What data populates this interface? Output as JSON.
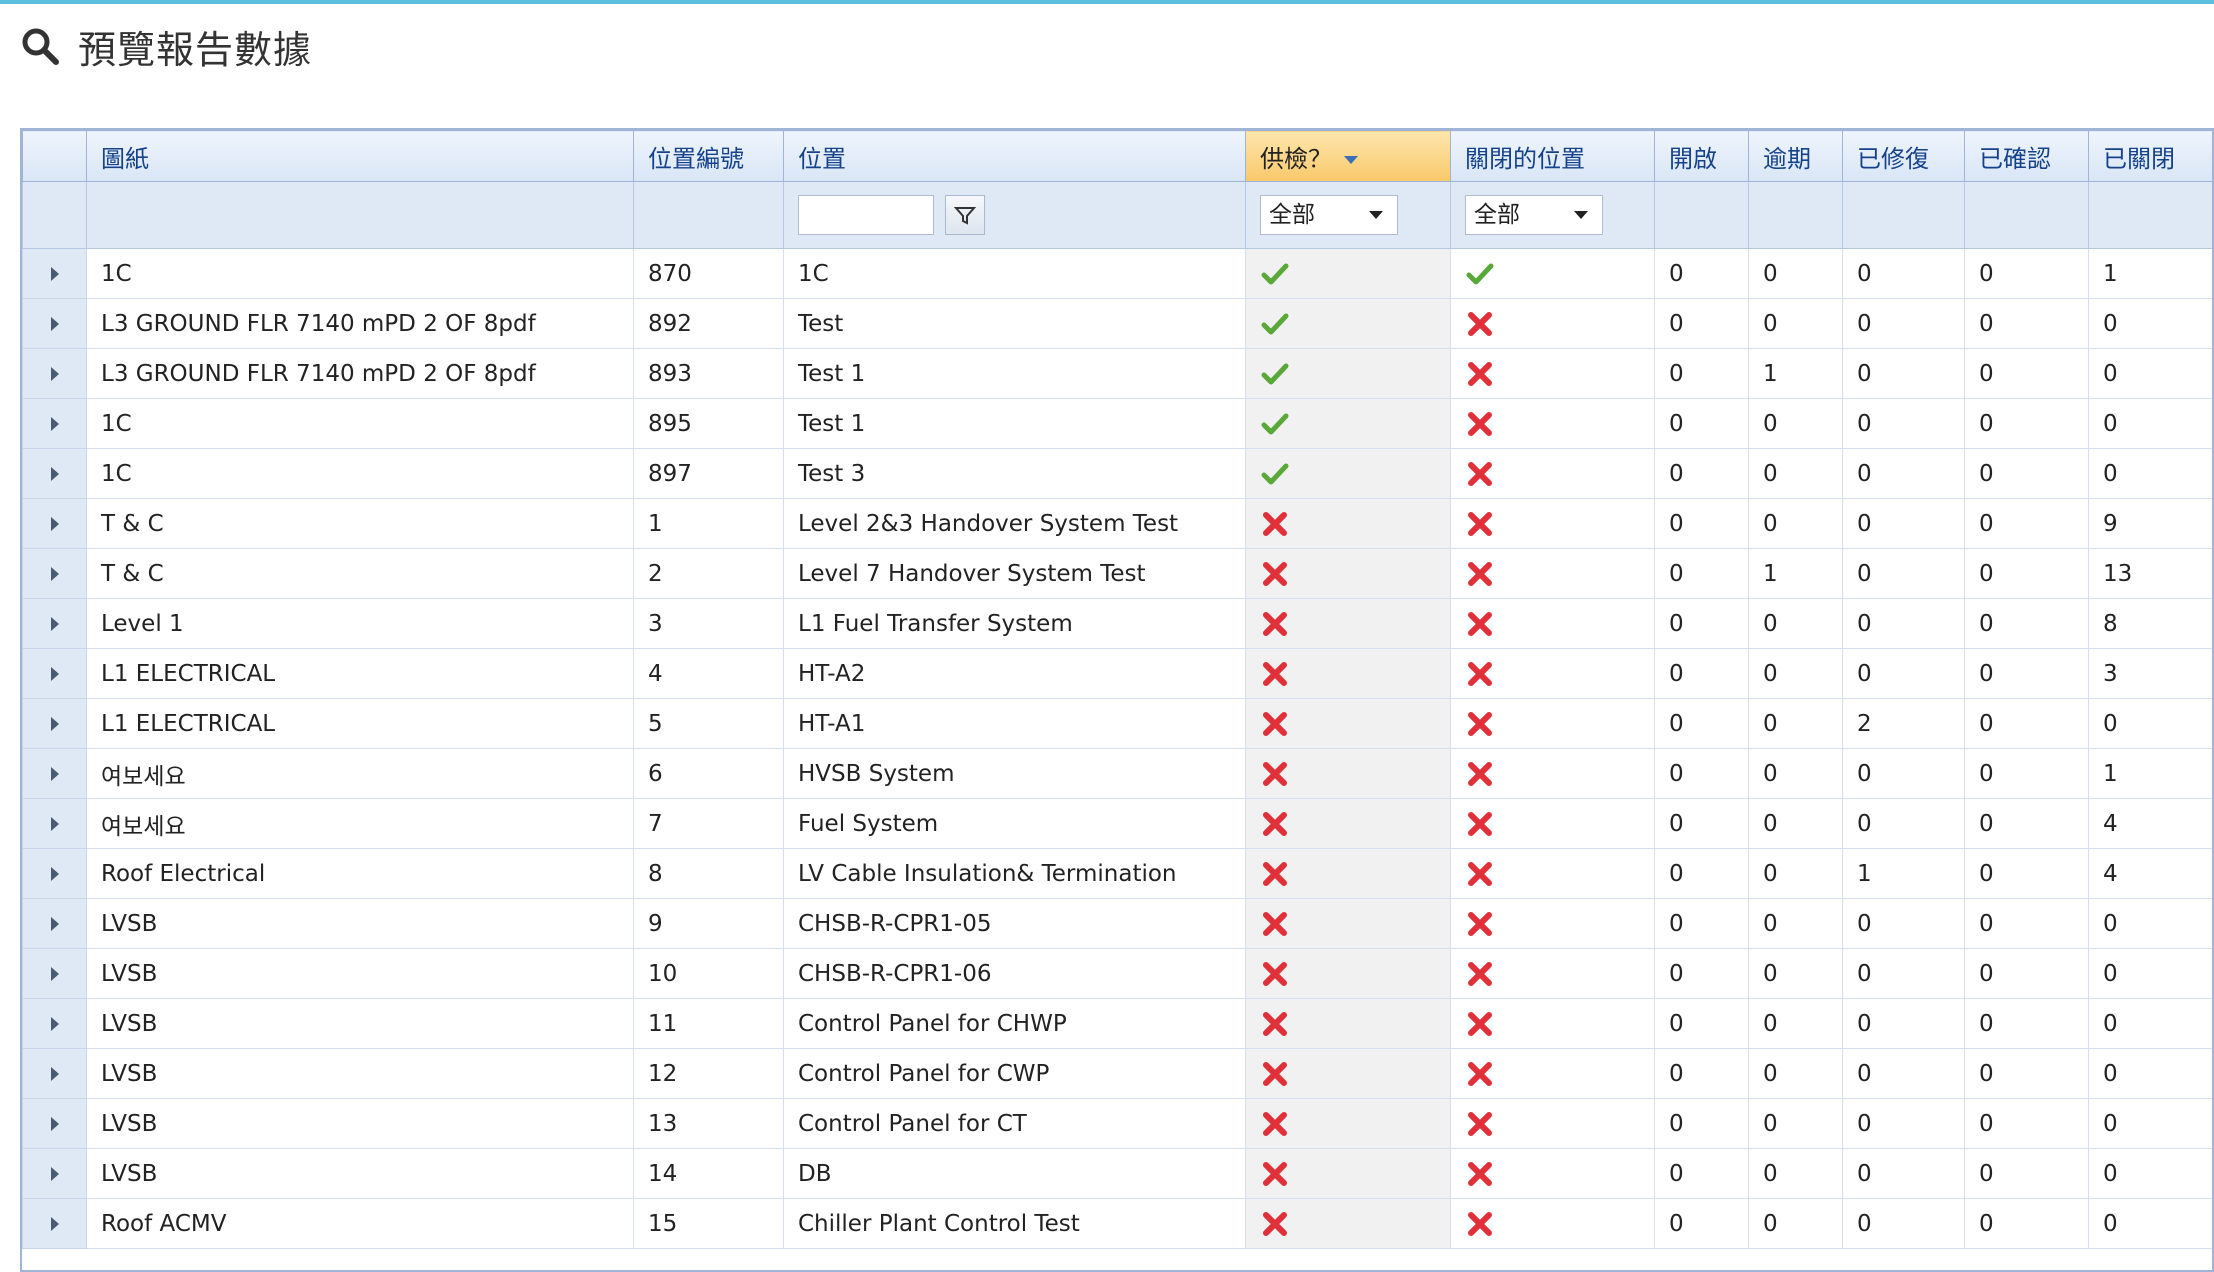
{
  "title": "預覽報告數據",
  "columns": [
    "圖紙",
    "位置編號",
    "位置",
    "供檢？",
    "關閉的位置",
    "開啟",
    "逾期",
    "已修復",
    "已確認",
    "已關閉"
  ],
  "filters": {
    "location_input": "",
    "inspection_select": "全部",
    "closed_select": "全部"
  },
  "rows": [
    {
      "drawing": "1C",
      "loc_no": "870",
      "location": "1C",
      "inspect": "check",
      "closed": "check",
      "open": "0",
      "overdue": "0",
      "fixed": "0",
      "confirmed": "0",
      "closed_count": "1"
    },
    {
      "drawing": "L3 GROUND FLR 7140 mPD 2 OF 8pdf",
      "loc_no": "892",
      "location": "Test",
      "inspect": "check",
      "closed": "cross",
      "open": "0",
      "overdue": "0",
      "fixed": "0",
      "confirmed": "0",
      "closed_count": "0"
    },
    {
      "drawing": "L3 GROUND FLR 7140 mPD 2 OF 8pdf",
      "loc_no": "893",
      "location": "Test 1",
      "inspect": "check",
      "closed": "cross",
      "open": "0",
      "overdue": "1",
      "fixed": "0",
      "confirmed": "0",
      "closed_count": "0"
    },
    {
      "drawing": "1C",
      "loc_no": "895",
      "location": "Test 1",
      "inspect": "check",
      "closed": "cross",
      "open": "0",
      "overdue": "0",
      "fixed": "0",
      "confirmed": "0",
      "closed_count": "0"
    },
    {
      "drawing": "1C",
      "loc_no": "897",
      "location": "Test 3",
      "inspect": "check",
      "closed": "cross",
      "open": "0",
      "overdue": "0",
      "fixed": "0",
      "confirmed": "0",
      "closed_count": "0"
    },
    {
      "drawing": "T & C",
      "loc_no": "1",
      "location": "Level 2&3 Handover System Test",
      "inspect": "cross",
      "closed": "cross",
      "open": "0",
      "overdue": "0",
      "fixed": "0",
      "confirmed": "0",
      "closed_count": "9"
    },
    {
      "drawing": "T & C",
      "loc_no": "2",
      "location": "Level 7 Handover System Test",
      "inspect": "cross",
      "closed": "cross",
      "open": "0",
      "overdue": "1",
      "fixed": "0",
      "confirmed": "0",
      "closed_count": "13"
    },
    {
      "drawing": "Level 1",
      "loc_no": "3",
      "location": "L1 Fuel Transfer System",
      "inspect": "cross",
      "closed": "cross",
      "open": "0",
      "overdue": "0",
      "fixed": "0",
      "confirmed": "0",
      "closed_count": "8"
    },
    {
      "drawing": "L1 ELECTRICAL",
      "loc_no": "4",
      "location": "HT-A2",
      "inspect": "cross",
      "closed": "cross",
      "open": "0",
      "overdue": "0",
      "fixed": "0",
      "confirmed": "0",
      "closed_count": "3"
    },
    {
      "drawing": "L1 ELECTRICAL",
      "loc_no": "5",
      "location": "HT-A1",
      "inspect": "cross",
      "closed": "cross",
      "open": "0",
      "overdue": "0",
      "fixed": "2",
      "confirmed": "0",
      "closed_count": "0"
    },
    {
      "drawing": "여보세요",
      "loc_no": "6",
      "location": "HVSB System",
      "inspect": "cross",
      "closed": "cross",
      "open": "0",
      "overdue": "0",
      "fixed": "0",
      "confirmed": "0",
      "closed_count": "1"
    },
    {
      "drawing": "여보세요",
      "loc_no": "7",
      "location": "Fuel System",
      "inspect": "cross",
      "closed": "cross",
      "open": "0",
      "overdue": "0",
      "fixed": "0",
      "confirmed": "0",
      "closed_count": "4"
    },
    {
      "drawing": "Roof Electrical",
      "loc_no": "8",
      "location": "LV Cable Insulation& Termination",
      "inspect": "cross",
      "closed": "cross",
      "open": "0",
      "overdue": "0",
      "fixed": "1",
      "confirmed": "0",
      "closed_count": "4"
    },
    {
      "drawing": "LVSB",
      "loc_no": "9",
      "location": "CHSB-R-CPR1-05",
      "inspect": "cross",
      "closed": "cross",
      "open": "0",
      "overdue": "0",
      "fixed": "0",
      "confirmed": "0",
      "closed_count": "0"
    },
    {
      "drawing": "LVSB",
      "loc_no": "10",
      "location": "CHSB-R-CPR1-06",
      "inspect": "cross",
      "closed": "cross",
      "open": "0",
      "overdue": "0",
      "fixed": "0",
      "confirmed": "0",
      "closed_count": "0"
    },
    {
      "drawing": "LVSB",
      "loc_no": "11",
      "location": "Control Panel for CHWP",
      "inspect": "cross",
      "closed": "cross",
      "open": "0",
      "overdue": "0",
      "fixed": "0",
      "confirmed": "0",
      "closed_count": "0"
    },
    {
      "drawing": "LVSB",
      "loc_no": "12",
      "location": "Control Panel for CWP",
      "inspect": "cross",
      "closed": "cross",
      "open": "0",
      "overdue": "0",
      "fixed": "0",
      "confirmed": "0",
      "closed_count": "0"
    },
    {
      "drawing": "LVSB",
      "loc_no": "13",
      "location": "Control Panel for CT",
      "inspect": "cross",
      "closed": "cross",
      "open": "0",
      "overdue": "0",
      "fixed": "0",
      "confirmed": "0",
      "closed_count": "0"
    },
    {
      "drawing": "LVSB",
      "loc_no": "14",
      "location": "DB",
      "inspect": "cross",
      "closed": "cross",
      "open": "0",
      "overdue": "0",
      "fixed": "0",
      "confirmed": "0",
      "closed_count": "0"
    },
    {
      "drawing": "Roof ACMV",
      "loc_no": "15",
      "location": "Chiller Plant Control Test",
      "inspect": "cross",
      "closed": "cross",
      "open": "0",
      "overdue": "0",
      "fixed": "0",
      "confirmed": "0",
      "closed_count": "0"
    }
  ]
}
